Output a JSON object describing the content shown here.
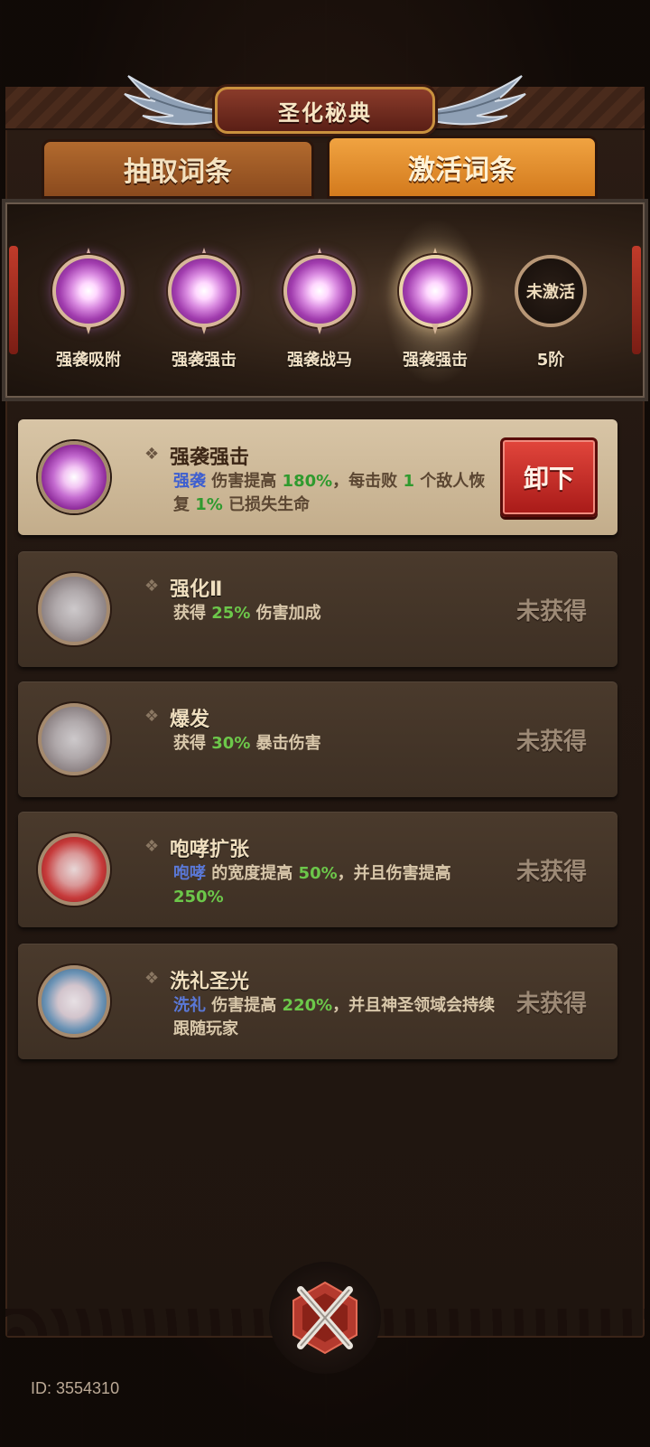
{
  "header": {
    "title": "圣化秘典"
  },
  "tabs": [
    {
      "label": "抽取词条",
      "active": false
    },
    {
      "label": "激活词条",
      "active": true
    }
  ],
  "slots": [
    {
      "label": "强袭吸附",
      "state": "filled"
    },
    {
      "label": "强袭强击",
      "state": "filled"
    },
    {
      "label": "强袭战马",
      "state": "filled"
    },
    {
      "label": "强袭强击",
      "state": "selected"
    },
    {
      "label": "5阶",
      "state": "locked",
      "orb_text": "未激活"
    }
  ],
  "entries": [
    {
      "title": "强袭强击",
      "desc": [
        "强袭",
        " 伤害提高 ",
        "180%",
        "，每击败 ",
        "1",
        " 个敌人恢复 ",
        "1%",
        " 已损失生命"
      ],
      "button": "卸下",
      "orb": "purple-icon"
    },
    {
      "title": "强化Ⅱ",
      "desc": [
        "获得 ",
        "25%",
        " 伤害加成"
      ],
      "status": "未获得",
      "orb": "grey-icon"
    },
    {
      "title": "爆发",
      "desc": [
        "获得 ",
        "30%",
        " 暴击伤害"
      ],
      "status": "未获得",
      "orb": "grey-icon"
    },
    {
      "title": "咆哮扩张",
      "desc": [
        "咆哮",
        " 的宽度提高 ",
        "50%",
        "，并且伤害提高 ",
        "250%"
      ],
      "status": "未获得",
      "orb": "red-icon"
    },
    {
      "title": "洗礼圣光",
      "desc": [
        "洗礼",
        " 伤害提高 ",
        "220%",
        "，并且神圣领域会持续跟随玩家"
      ],
      "status": "未获得",
      "orb": "blue-icon"
    }
  ],
  "footer": {
    "id_text": "ID: 3554310"
  },
  "colors": {
    "accent_orange": "#e08a2a",
    "keyword_blue": "#5a78d6",
    "number_green": "#6cc74a",
    "button_red": "#c8302a"
  }
}
